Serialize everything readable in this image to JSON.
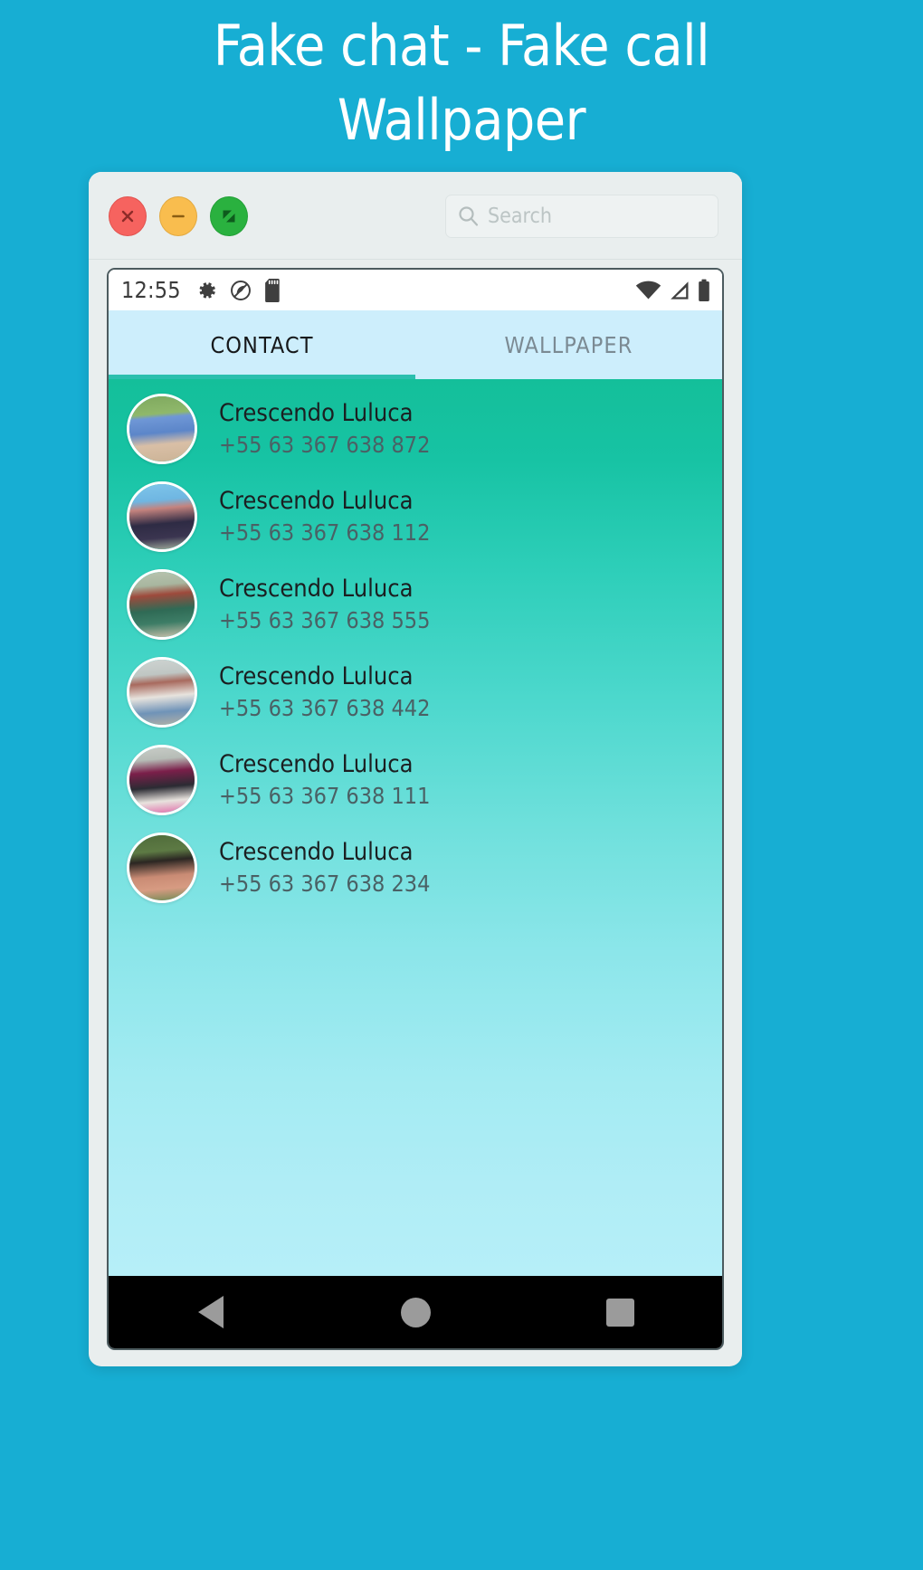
{
  "background_color": "#17AED3",
  "header": {
    "title_line1": "Fake chat - Fake call",
    "title_line2": "Wallpaper",
    "title_color": "#FFFFFF"
  },
  "window": {
    "chrome_color": "#E9EEEE",
    "traffic_lights": [
      {
        "name": "close",
        "color": "#F6635F",
        "glyph": "x"
      },
      {
        "name": "minimize",
        "color": "#F9BD4E",
        "glyph": "minus"
      },
      {
        "name": "maximize",
        "color": "#2AB13F",
        "glyph": "fullscreen"
      }
    ],
    "search": {
      "placeholder": "Search",
      "value": "",
      "icon": "search-icon"
    }
  },
  "phone": {
    "statusbar": {
      "time": "12:55",
      "left_icons": [
        "gear-icon",
        "do-not-disturb-icon",
        "sd-card-icon"
      ],
      "right_icons": [
        "wifi-icon",
        "cellular-signal-icon",
        "battery-icon"
      ],
      "background": "#FFFFFF"
    },
    "tabs": {
      "background": "#CDEEFC",
      "indicator_color": "#2BBFAE",
      "items": [
        {
          "label": "CONTACT",
          "active": true
        },
        {
          "label": "WALLPAPER",
          "active": false
        }
      ]
    },
    "list": {
      "gradient_from": "#14BF9A",
      "gradient_to": "#B6EFF8",
      "contacts": [
        {
          "name": "Crescendo Luluca",
          "number": "+55 63 367 638 872",
          "avatar": "avatar-denim-jacket"
        },
        {
          "name": "Crescendo Luluca",
          "number": "+55 63 367 638 112",
          "avatar": "avatar-floral-dress"
        },
        {
          "name": "Crescendo Luluca",
          "number": "+55 63 367 638 555",
          "avatar": "avatar-green-top"
        },
        {
          "name": "Crescendo Luluca",
          "number": "+55 63 367 638 442",
          "avatar": "avatar-white-shirt"
        },
        {
          "name": "Crescendo Luluca",
          "number": "+55 63 367 638 111",
          "avatar": "avatar-pink-hair"
        },
        {
          "name": "Crescendo Luluca",
          "number": "+55 63 367 638 234",
          "avatar": "avatar-outdoors"
        }
      ]
    },
    "navbar": {
      "background": "#000000",
      "buttons": [
        {
          "name": "back",
          "shape": "triangle"
        },
        {
          "name": "home",
          "shape": "circle"
        },
        {
          "name": "recents",
          "shape": "square"
        }
      ]
    }
  }
}
